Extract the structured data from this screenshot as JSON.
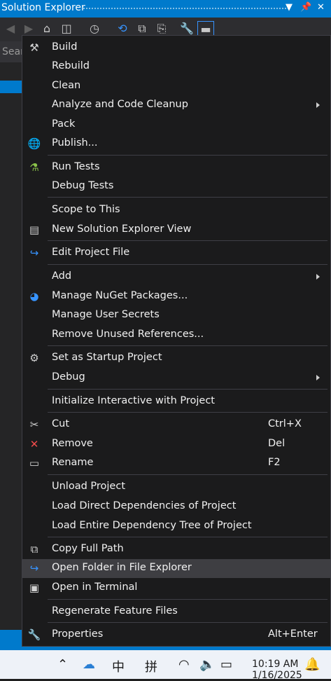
{
  "window": {
    "title": "Solution Explorer"
  },
  "search": {
    "placeholder": "Sear"
  },
  "menu": {
    "items": [
      {
        "name": "build-menu-item",
        "icon": "build-icon",
        "glyph": "⚒",
        "color": "#d0d0d0",
        "label": "Build",
        "shortcut": "",
        "submenu": false
      },
      {
        "name": "rebuild-menu-item",
        "icon": "",
        "glyph": "",
        "color": "",
        "label": "Rebuild",
        "shortcut": "",
        "submenu": false
      },
      {
        "name": "clean-menu-item",
        "icon": "",
        "glyph": "",
        "color": "",
        "label": "Clean",
        "shortcut": "",
        "submenu": false
      },
      {
        "name": "analyze-code-cleanup-menu-item",
        "icon": "",
        "glyph": "",
        "color": "",
        "label": "Analyze and Code Cleanup",
        "shortcut": "",
        "submenu": true
      },
      {
        "name": "pack-menu-item",
        "icon": "",
        "glyph": "",
        "color": "",
        "label": "Pack",
        "shortcut": "",
        "submenu": false
      },
      {
        "name": "publish-menu-item",
        "icon": "globe-icon",
        "glyph": "🌐",
        "color": "#3794ff",
        "label": "Publish...",
        "shortcut": "",
        "submenu": false,
        "sep_after": true
      },
      {
        "name": "run-tests-menu-item",
        "icon": "flask-icon",
        "glyph": "⚗",
        "color": "#8bc34a",
        "label": "Run Tests",
        "shortcut": "",
        "submenu": false
      },
      {
        "name": "debug-tests-menu-item",
        "icon": "",
        "glyph": "",
        "color": "",
        "label": "Debug Tests",
        "shortcut": "",
        "submenu": false,
        "sep_after": true
      },
      {
        "name": "scope-to-this-menu-item",
        "icon": "",
        "glyph": "",
        "color": "",
        "label": "Scope to This",
        "shortcut": "",
        "submenu": false
      },
      {
        "name": "new-solution-explorer-view-menu-item",
        "icon": "new-view-icon",
        "glyph": "▤",
        "color": "#c8c8c8",
        "label": "New Solution Explorer View",
        "shortcut": "",
        "submenu": false,
        "sep_after": true
      },
      {
        "name": "edit-project-file-menu-item",
        "icon": "redo-arrow-icon",
        "glyph": "↪",
        "color": "#3794ff",
        "label": "Edit Project File",
        "shortcut": "",
        "submenu": false,
        "sep_after": true
      },
      {
        "name": "add-menu-item",
        "icon": "",
        "glyph": "",
        "color": "",
        "label": "Add",
        "shortcut": "",
        "submenu": true
      },
      {
        "name": "manage-nuget-packages-menu-item",
        "icon": "nuget-icon",
        "glyph": "◕",
        "color": "#3794ff",
        "label": "Manage NuGet Packages...",
        "shortcut": "",
        "submenu": false
      },
      {
        "name": "manage-user-secrets-menu-item",
        "icon": "",
        "glyph": "",
        "color": "",
        "label": "Manage User Secrets",
        "shortcut": "",
        "submenu": false
      },
      {
        "name": "remove-unused-references-menu-item",
        "icon": "",
        "glyph": "",
        "color": "",
        "label": "Remove Unused References...",
        "shortcut": "",
        "submenu": false,
        "sep_after": true
      },
      {
        "name": "set-as-startup-project-menu-item",
        "icon": "gear-icon",
        "glyph": "⚙",
        "color": "#d0d0d0",
        "label": "Set as Startup Project",
        "shortcut": "",
        "submenu": false
      },
      {
        "name": "debug-menu-item",
        "icon": "",
        "glyph": "",
        "color": "",
        "label": "Debug",
        "shortcut": "",
        "submenu": true,
        "sep_after": true
      },
      {
        "name": "initialize-interactive-menu-item",
        "icon": "",
        "glyph": "",
        "color": "",
        "label": "Initialize Interactive with Project",
        "shortcut": "",
        "submenu": false,
        "sep_after": true
      },
      {
        "name": "cut-menu-item",
        "icon": "scissors-icon",
        "glyph": "✂",
        "color": "#d0d0d0",
        "label": "Cut",
        "shortcut": "Ctrl+X",
        "submenu": false
      },
      {
        "name": "remove-menu-item",
        "icon": "close-icon",
        "glyph": "✕",
        "color": "#f14c4c",
        "label": "Remove",
        "shortcut": "Del",
        "submenu": false
      },
      {
        "name": "rename-menu-item",
        "icon": "rename-icon",
        "glyph": "▭",
        "color": "#d0d0d0",
        "label": "Rename",
        "shortcut": "F2",
        "submenu": false,
        "sep_after": true
      },
      {
        "name": "unload-project-menu-item",
        "icon": "",
        "glyph": "",
        "color": "",
        "label": "Unload Project",
        "shortcut": "",
        "submenu": false
      },
      {
        "name": "load-direct-dependencies-menu-item",
        "icon": "",
        "glyph": "",
        "color": "",
        "label": "Load Direct Dependencies of Project",
        "shortcut": "",
        "submenu": false
      },
      {
        "name": "load-entire-dependency-tree-menu-item",
        "icon": "",
        "glyph": "",
        "color": "",
        "label": "Load Entire Dependency Tree of Project",
        "shortcut": "",
        "submenu": false,
        "sep_after": true
      },
      {
        "name": "copy-full-path-menu-item",
        "icon": "copy-icon",
        "glyph": "⧉",
        "color": "#d0d0d0",
        "label": "Copy Full Path",
        "shortcut": "",
        "submenu": false
      },
      {
        "name": "open-folder-in-file-explorer-menu-item",
        "icon": "redo-arrow-icon",
        "glyph": "↪",
        "color": "#3794ff",
        "label": "Open Folder in File Explorer",
        "shortcut": "",
        "submenu": false,
        "highlighted": true
      },
      {
        "name": "open-in-terminal-menu-item",
        "icon": "terminal-icon",
        "glyph": "▣",
        "color": "#d0d0d0",
        "label": "Open in Terminal",
        "shortcut": "",
        "submenu": false,
        "sep_after": true
      },
      {
        "name": "regenerate-feature-files-menu-item",
        "icon": "",
        "glyph": "",
        "color": "",
        "label": "Regenerate Feature Files",
        "shortcut": "",
        "submenu": false,
        "sep_after": true
      },
      {
        "name": "properties-menu-item",
        "icon": "wrench-icon",
        "glyph": "🔧",
        "color": "#d0d0d0",
        "label": "Properties",
        "shortcut": "Alt+Enter",
        "submenu": false
      }
    ]
  },
  "taskbar": {
    "ime_chinese": "中",
    "ime_pinyin": "拼",
    "time": "10:19 AM",
    "date": "1/16/2025"
  },
  "colors": {
    "accent": "#007acc",
    "menu_bg": "#1b1b1c",
    "highlight": "#3e3e42"
  }
}
